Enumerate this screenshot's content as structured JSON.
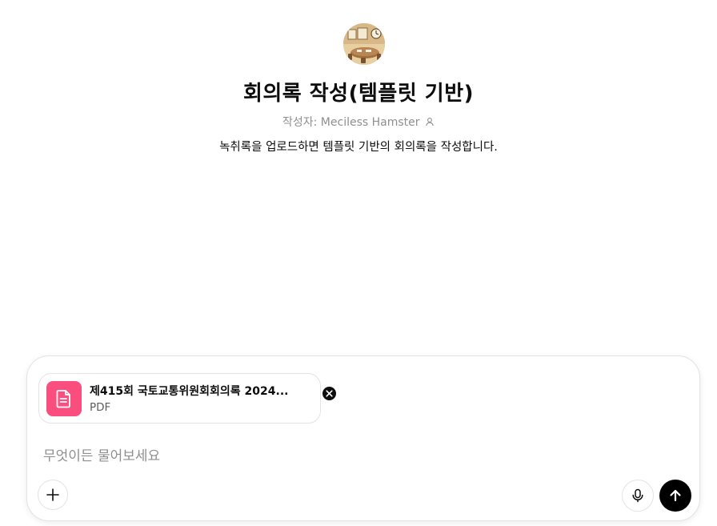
{
  "gpt": {
    "title": "회의록 작성(템플릿 기반)",
    "author_label": "작성자: Meciless Hamster",
    "description": "녹취록을 업로드하면 템플릿 기반의 회의록을 작성합니다.",
    "avatar_icon": "meeting-room-illustration"
  },
  "composer": {
    "attachment": {
      "name": "제415회 국토교통위원회회의록 2024...",
      "type": "PDF",
      "icon": "document-icon",
      "icon_color": "#fa4e7f"
    },
    "placeholder": "무엇이든 물어보세요",
    "value": "",
    "icons": {
      "add": "plus-icon",
      "voice": "microphone-icon",
      "send": "arrow-up-icon",
      "remove": "close-icon"
    }
  }
}
